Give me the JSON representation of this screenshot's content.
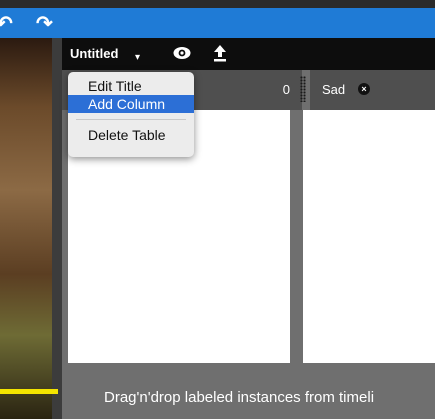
{
  "nav": {
    "undo_glyph": "↶",
    "redo_glyph": "↷"
  },
  "toolbar": {
    "table_title": "Untitled",
    "eye_icon": "eye-icon",
    "upload_icon": "upload-icon"
  },
  "menu": {
    "items": [
      {
        "label": "Edit Title",
        "active": false
      },
      {
        "label": "Add Column",
        "active": true
      },
      {
        "label": "Delete Table",
        "active": false
      }
    ]
  },
  "columns": [
    {
      "name": "",
      "count": "0"
    },
    {
      "name": "Sad",
      "close_glyph": "×"
    }
  ],
  "hint": "Drag'n'drop labeled instances from timeli",
  "colors": {
    "topbar": "#1f7bd6",
    "toolbar": "#0d0d0d",
    "menu_highlight": "#2c6fd6",
    "panel_bg": "#6f6f6f",
    "timeline_marker": "#f4e400"
  }
}
